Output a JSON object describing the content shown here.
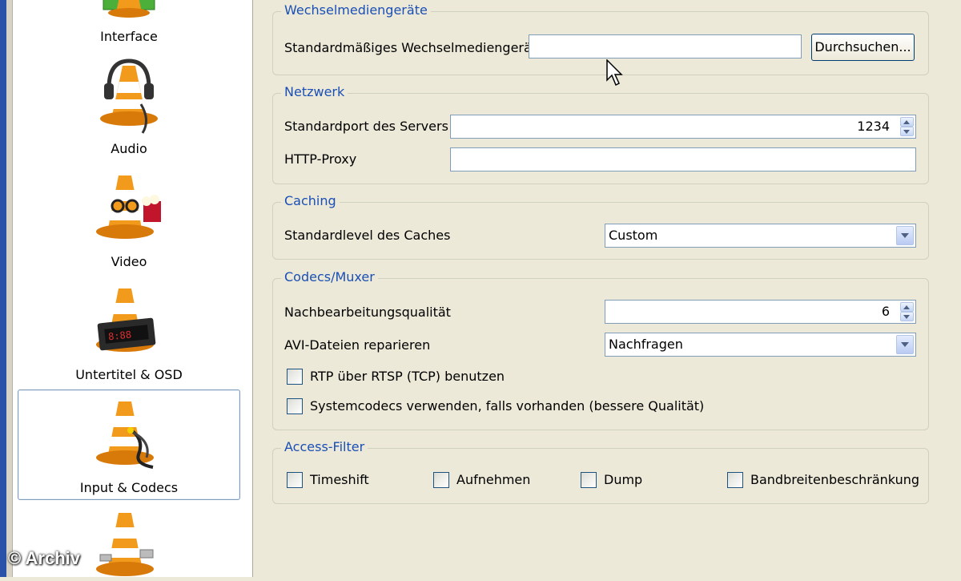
{
  "sidebar": {
    "items": [
      {
        "label": "Interface",
        "selected": false
      },
      {
        "label": "Audio",
        "selected": false
      },
      {
        "label": "Video",
        "selected": false
      },
      {
        "label": "Untertitel & OSD",
        "selected": false
      },
      {
        "label": "Input & Codecs",
        "selected": true
      }
    ]
  },
  "watermark": "© Archiv",
  "groups": {
    "removable": {
      "title": "Wechselmediengeräte",
      "device_label": "Standardmäßiges Wechselmediengerät",
      "device_value": "",
      "browse_label": "Durchsuchen..."
    },
    "network": {
      "title": "Netzwerk",
      "port_label": "Standardport des Servers",
      "port_value": "1234",
      "proxy_label": "HTTP-Proxy",
      "proxy_value": ""
    },
    "caching": {
      "title": "Caching",
      "level_label": "Standardlevel des Caches",
      "level_value": "Custom"
    },
    "codecs": {
      "title": "Codecs/Muxer",
      "pp_label": "Nachbearbeitungsqualität",
      "pp_value": "6",
      "avi_label": "AVI-Dateien reparieren",
      "avi_value": "Nachfragen",
      "rtp_label": "RTP über RTSP (TCP) benutzen",
      "rtp_checked": false,
      "syscodec_label": "Systemcodecs verwenden, falls vorhanden (bessere Qualität)",
      "syscodec_checked": false
    },
    "access": {
      "title": "Access-Filter",
      "filters": [
        {
          "label": "Timeshift",
          "checked": false
        },
        {
          "label": "Aufnehmen",
          "checked": false
        },
        {
          "label": "Dump",
          "checked": false
        },
        {
          "label": "Bandbreitenbeschränkung",
          "checked": false
        }
      ]
    }
  },
  "colors": {
    "group_title": "#1a4fb5",
    "window_bg": "#ece9d8",
    "field_border": "#7f9db9"
  },
  "icons": [
    "vlc-cone-interface-icon",
    "vlc-cone-audio-icon",
    "vlc-cone-video-icon",
    "vlc-cone-subtitles-icon",
    "vlc-cone-input-icon",
    "vlc-cone-advanced-icon",
    "mouse-cursor-icon"
  ]
}
